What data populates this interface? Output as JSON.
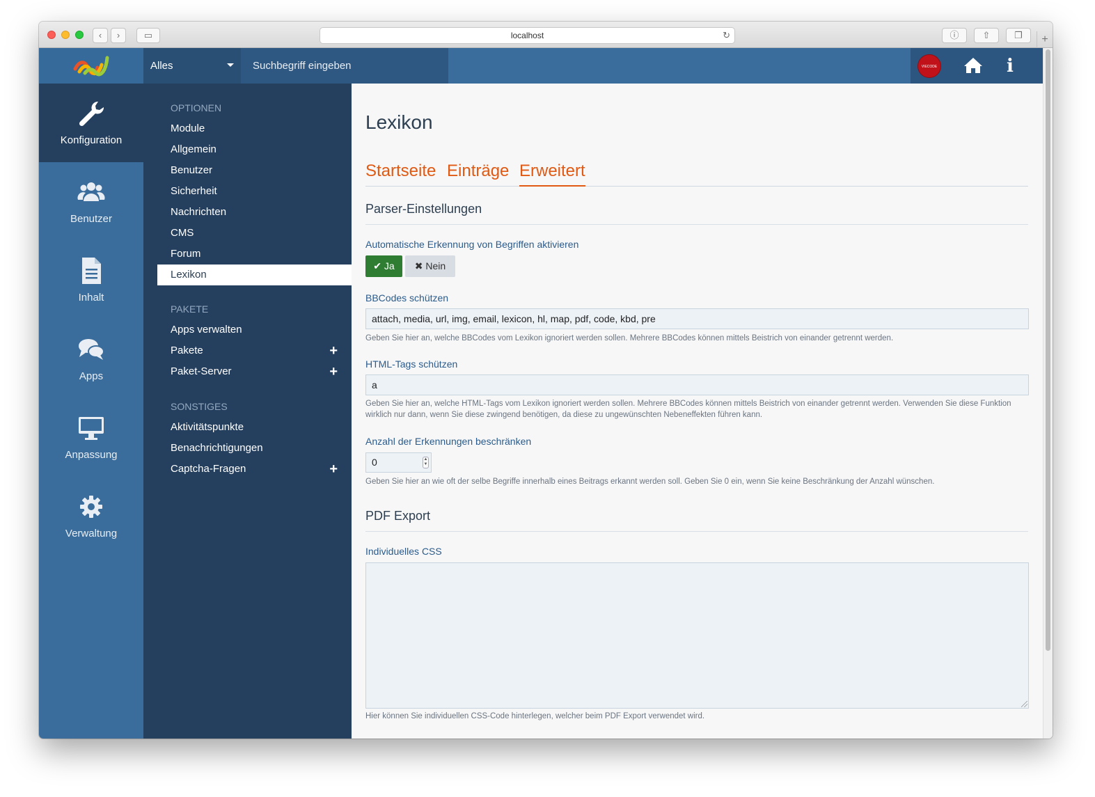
{
  "browser": {
    "url": "localhost"
  },
  "header": {
    "search_scope": "Alles",
    "search_placeholder": "Suchbegriff eingeben",
    "avatar_text": "VIECODE"
  },
  "icon_nav": [
    {
      "label": "Konfiguration",
      "icon": "wrench-icon"
    },
    {
      "label": "Benutzer",
      "icon": "users-icon"
    },
    {
      "label": "Inhalt",
      "icon": "document-icon"
    },
    {
      "label": "Apps",
      "icon": "comments-icon"
    },
    {
      "label": "Anpassung",
      "icon": "desktop-icon"
    },
    {
      "label": "Verwaltung",
      "icon": "gear-icon"
    }
  ],
  "menu": {
    "optionen_head": "OPTIONEN",
    "optionen": [
      "Module",
      "Allgemein",
      "Benutzer",
      "Sicherheit",
      "Nachrichten",
      "CMS",
      "Forum",
      "Lexikon"
    ],
    "pakete_head": "PAKETE",
    "pakete": [
      "Apps verwalten",
      "Pakete",
      "Paket-Server"
    ],
    "sonstiges_head": "SONSTIGES",
    "sonstiges": [
      "Aktivitätspunkte",
      "Benachrichtigungen",
      "Captcha-Fragen"
    ]
  },
  "main": {
    "title": "Lexikon",
    "tabs": [
      "Startseite",
      "Einträge",
      "Erweitert"
    ],
    "parser_section": "Parser-Einstellungen",
    "auto_label": "Automatische Erkennung von Begriffen aktivieren",
    "yes_label": "Ja",
    "no_label": "Nein",
    "bbcodes_label": "BBCodes schützen",
    "bbcodes_value": "attach, media, url, img, email, lexicon, hl, map, pdf, code, kbd, pre",
    "bbcodes_help": "Geben Sie hier an, welche BBCodes vom Lexikon ignoriert werden sollen. Mehrere BBCodes können mittels Beistrich von einander getrennt werden.",
    "html_label": "HTML-Tags schützen",
    "html_value": "a",
    "html_help": "Geben Sie hier an, welche HTML-Tags vom Lexikon ignoriert werden sollen. Mehrere BBCodes können mittels Beistrich von einander getrennt werden. Verwenden Sie diese Funktion wirklich nur dann, wenn Sie diese zwingend benötigen, da diese zu ungewünschten Nebeneffekten führen kann.",
    "limit_label": "Anzahl der Erkennungen beschränken",
    "limit_value": "0",
    "limit_help": "Geben Sie hier an wie oft der selbe Begriffe innerhalb eines Beitrags erkannt werden soll. Geben Sie 0 ein, wenn Sie keine Beschränkung der Anzahl wünschen.",
    "pdf_section": "PDF Export",
    "css_label": "Individuelles CSS",
    "css_help": "Hier können Sie individuellen CSS-Code hinterlegen, welcher beim PDF Export verwendet wird."
  },
  "colors": {
    "accent": "#e05a14",
    "nav_dark": "#25405f",
    "nav_blue": "#3a6d9c",
    "success": "#2e7d32"
  }
}
